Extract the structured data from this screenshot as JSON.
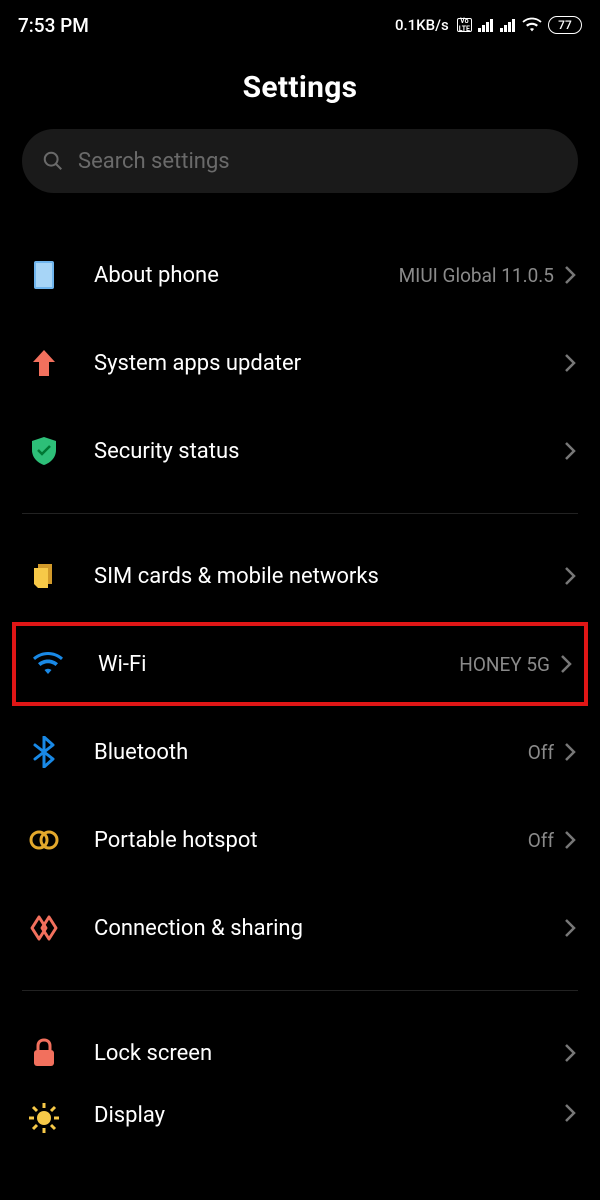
{
  "status": {
    "time": "7:53 PM",
    "net_speed": "0.1KB/s",
    "battery_percent": "77"
  },
  "header": {
    "title": "Settings"
  },
  "search": {
    "placeholder": "Search settings"
  },
  "rows": {
    "about": {
      "label": "About phone",
      "value": "MIUI Global 11.0.5"
    },
    "updater": {
      "label": "System apps updater"
    },
    "security": {
      "label": "Security status"
    },
    "sim": {
      "label": "SIM cards & mobile networks"
    },
    "wifi": {
      "label": "Wi-Fi",
      "value": "HONEY 5G"
    },
    "bluetooth": {
      "label": "Bluetooth",
      "value": "Off"
    },
    "hotspot": {
      "label": "Portable hotspot",
      "value": "Off"
    },
    "connshare": {
      "label": "Connection & sharing"
    },
    "lockscreen": {
      "label": "Lock screen"
    },
    "display": {
      "label": "Display"
    }
  }
}
